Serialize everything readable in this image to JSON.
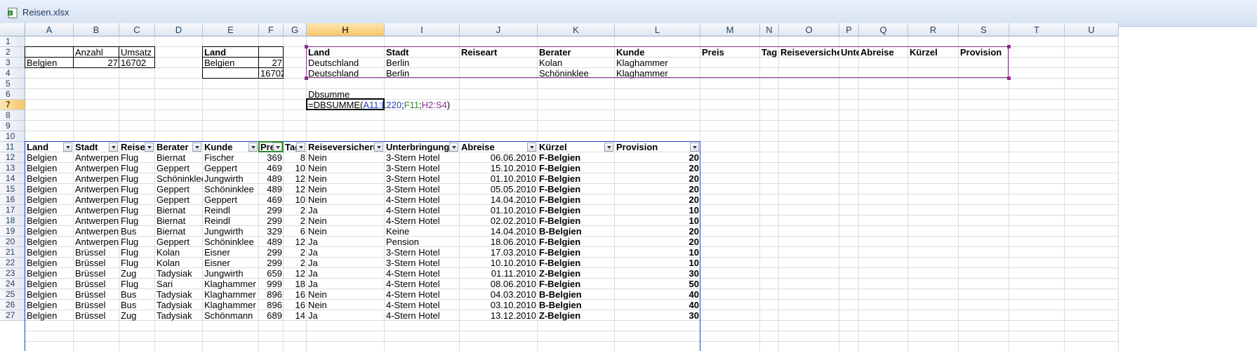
{
  "window": {
    "title": "Reisen.xlsx"
  },
  "columns": [
    "A",
    "B",
    "C",
    "D",
    "E",
    "F",
    "G",
    "H",
    "I",
    "J",
    "K",
    "L",
    "M",
    "N",
    "O",
    "P",
    "Q",
    "R",
    "S",
    "T",
    "U"
  ],
  "rows": [
    "1",
    "2",
    "3",
    "4",
    "5",
    "6",
    "7",
    "8",
    "9",
    "10",
    "11",
    "12",
    "13",
    "14",
    "15",
    "16",
    "17",
    "18",
    "19",
    "20",
    "21",
    "22",
    "23",
    "24",
    "25",
    "26",
    "27"
  ],
  "summary_small": {
    "header": [
      "Anzahl",
      "Umsatz"
    ],
    "row": [
      "Belgien",
      "27",
      "16702"
    ]
  },
  "summary_land": {
    "header": "Land",
    "land": "Belgien",
    "count": "27",
    "sum": "16702"
  },
  "criteria": {
    "header": [
      "Land",
      "Stadt",
      "Reiseart",
      "Berater",
      "Kunde",
      "Preis",
      "Tag",
      "Reiseversicherung",
      "Unte",
      "Abreise",
      "Kürzel",
      "Provision"
    ],
    "rows": [
      [
        "Deutschland",
        "Berlin",
        "",
        "Kolan",
        "Klaghammer"
      ],
      [
        "Deutschland",
        "Berlin",
        "",
        "Schöninklee",
        "Klaghammer"
      ]
    ]
  },
  "dbsumme": {
    "label": "Dbsumme",
    "formula_prefix": "=DBSUMME(",
    "range1": "A11:L220",
    "sep1": ";",
    "field": "F11",
    "sep2": ";",
    "range2": "H2:S4",
    "close": ")"
  },
  "table": {
    "headers": [
      "Land",
      "Stadt",
      "Reiseart",
      "Berater",
      "Kunde",
      "Preis",
      "Tage",
      "Reiseversicherung",
      "Unterbringung",
      "Abreise",
      "Kürzel",
      "Provision"
    ],
    "rows": [
      [
        "Belgien",
        "Antwerpen",
        "Flug",
        "Biernat",
        "Fischer",
        "369",
        "8",
        "Nein",
        "3-Stern Hotel",
        "06.06.2010",
        "F-Belgien",
        "20"
      ],
      [
        "Belgien",
        "Antwerpen",
        "Flug",
        "Geppert",
        "Geppert",
        "469",
        "10",
        "Nein",
        "3-Stern Hotel",
        "15.10.2010",
        "F-Belgien",
        "20"
      ],
      [
        "Belgien",
        "Antwerpen",
        "Flug",
        "Schöninklee",
        "Jungwirth",
        "489",
        "12",
        "Nein",
        "3-Stern Hotel",
        "01.10.2010",
        "F-Belgien",
        "20"
      ],
      [
        "Belgien",
        "Antwerpen",
        "Flug",
        "Geppert",
        "Schöninklee",
        "489",
        "12",
        "Nein",
        "3-Stern Hotel",
        "05.05.2010",
        "F-Belgien",
        "20"
      ],
      [
        "Belgien",
        "Antwerpen",
        "Flug",
        "Geppert",
        "Geppert",
        "469",
        "10",
        "Nein",
        "4-Stern Hotel",
        "14.04.2010",
        "F-Belgien",
        "20"
      ],
      [
        "Belgien",
        "Antwerpen",
        "Flug",
        "Biernat",
        "Reindl",
        "299",
        "2",
        "Ja",
        "4-Stern Hotel",
        "01.10.2010",
        "F-Belgien",
        "10"
      ],
      [
        "Belgien",
        "Antwerpen",
        "Flug",
        "Biernat",
        "Reindl",
        "299",
        "2",
        "Nein",
        "4-Stern Hotel",
        "02.02.2010",
        "F-Belgien",
        "10"
      ],
      [
        "Belgien",
        "Antwerpen",
        "Bus",
        "Biernat",
        "Jungwirth",
        "329",
        "6",
        "Nein",
        "Keine",
        "14.04.2010",
        "B-Belgien",
        "20"
      ],
      [
        "Belgien",
        "Antwerpen",
        "Flug",
        "Geppert",
        "Schöninklee",
        "489",
        "12",
        "Ja",
        "Pension",
        "18.06.2010",
        "F-Belgien",
        "20"
      ],
      [
        "Belgien",
        "Brüssel",
        "Flug",
        "Kolan",
        "Eisner",
        "299",
        "2",
        "Ja",
        "3-Stern Hotel",
        "17.03.2010",
        "F-Belgien",
        "10"
      ],
      [
        "Belgien",
        "Brüssel",
        "Flug",
        "Kolan",
        "Eisner",
        "299",
        "2",
        "Ja",
        "3-Stern Hotel",
        "10.10.2010",
        "F-Belgien",
        "10"
      ],
      [
        "Belgien",
        "Brüssel",
        "Zug",
        "Tadysiak",
        "Jungwirth",
        "659",
        "12",
        "Ja",
        "4-Stern Hotel",
        "01.11.2010",
        "Z-Belgien",
        "30"
      ],
      [
        "Belgien",
        "Brüssel",
        "Flug",
        "Sari",
        "Klaghammer",
        "999",
        "18",
        "Ja",
        "4-Stern Hotel",
        "08.06.2010",
        "F-Belgien",
        "50"
      ],
      [
        "Belgien",
        "Brüssel",
        "Bus",
        "Tadysiak",
        "Klaghammer",
        "896",
        "16",
        "Nein",
        "4-Stern Hotel",
        "04.03.2010",
        "B-Belgien",
        "40"
      ],
      [
        "Belgien",
        "Brüssel",
        "Bus",
        "Tadysiak",
        "Klaghammer",
        "896",
        "16",
        "Nein",
        "4-Stern Hotel",
        "03.10.2010",
        "B-Belgien",
        "40"
      ],
      [
        "Belgien",
        "Brüssel",
        "Zug",
        "Tadysiak",
        "Schönmann",
        "689",
        "14",
        "Ja",
        "4-Stern Hotel",
        "13.12.2010",
        "Z-Belgien",
        "30"
      ]
    ]
  },
  "colors": {
    "range1": "#1f3fbf",
    "field": "#2e8b2e",
    "range2": "#8b2f8b",
    "selection_header": "#f8c66a"
  }
}
